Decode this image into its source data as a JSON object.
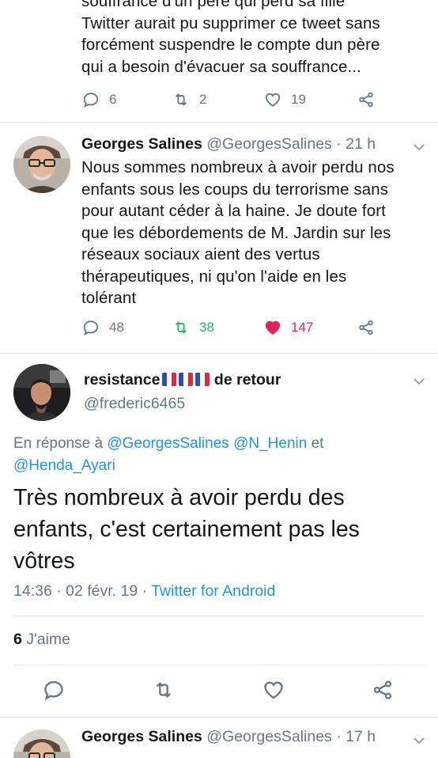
{
  "top_tweet": {
    "lines": [
      "souffrance d'un père qui perd sa fille",
      "Twitter aurait pu supprimer ce tweet sans",
      "forcément suspendre le compte dun père",
      "qui a besoin d'évacuer sa souffrance..."
    ],
    "replies": "6",
    "retweets": "2",
    "likes": "19"
  },
  "tweet2": {
    "name": "Georges Salines",
    "handle": "@GeorgesSalines",
    "time": "· 21 h",
    "lines": [
      "Nous sommes nombreux à avoir perdu nos",
      "enfants sous les coups du terrorisme sans",
      "pour autant céder à la haine. Je doute fort",
      "que les débordements de M. Jardin sur les",
      "réseaux sociaux aient des vertus",
      "thérapeutiques, ni qu'on l'aide en les",
      "tolérant"
    ],
    "replies": "48",
    "retweets": "38",
    "likes": "147",
    "retweet_color": "#17bf63",
    "like_color": "#e0245e"
  },
  "main_tweet": {
    "name": "resistance",
    "name_suffix": "de retour",
    "handle": "@frederic6465",
    "reply_prefix": "En réponse à",
    "reply_to": [
      "@GeorgesSalines",
      "@N_Henin",
      "@Henda_Ayari"
    ],
    "reply_and": "et",
    "text_lines": [
      "Très nombreux à avoir perdu des",
      "enfants, c'est certainement pas les",
      "vôtres"
    ],
    "timestamp": "14:36 · 02 févr. 19 ·",
    "source": "Twitter for Android",
    "like_count": "6",
    "like_label": "J'aime"
  },
  "bottom_tweet": {
    "name": "Georges Salines",
    "handle": "@GeorgesSalines",
    "time": "· 17 h"
  },
  "icons": {
    "reply": "reply-icon",
    "retweet": "retweet-icon",
    "like": "heart-icon",
    "share": "share-icon",
    "more": "chevron-down-icon"
  },
  "colors": {
    "link": "#1b95e0",
    "secondary_text": "#657786",
    "divider": "#e1e8ed"
  }
}
